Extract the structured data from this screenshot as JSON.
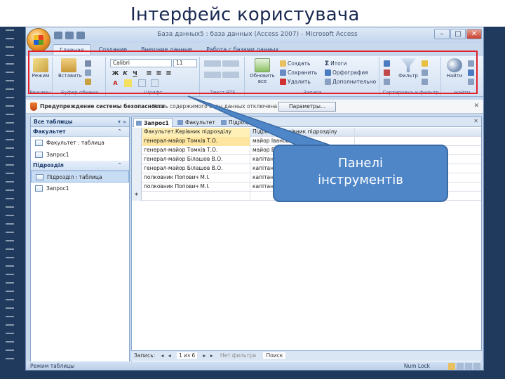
{
  "slide": {
    "title": "Інтерфейс користувача",
    "callout": {
      "line1": "Панелі",
      "line2": "інструментів"
    }
  },
  "window": {
    "title": "База данных5 : база данных (Access 2007) - Microsoft Access",
    "controls": {
      "minimize": "–",
      "maximize": "□",
      "close": "✕"
    }
  },
  "ribbon": {
    "tabs": [
      {
        "label": "Главная",
        "active": true
      },
      {
        "label": "Создание",
        "active": false
      },
      {
        "label": "Внешние данные",
        "active": false
      },
      {
        "label": "Работа с базами данных",
        "active": false
      }
    ],
    "groups": {
      "modes": {
        "label": "Режимы",
        "button": "Режим"
      },
      "clipboard": {
        "label": "Буфер обмена",
        "button": "Вставить"
      },
      "font": {
        "label": "Шрифт",
        "font_name": "Calibri",
        "font_size": "11",
        "bold": "Ж",
        "italic": "К",
        "underline": "Ч"
      },
      "rich_text": {
        "label": "Текст RTF"
      },
      "records": {
        "label": "Записи",
        "refresh": "Обновить все",
        "create": "Создать",
        "save": "Сохранить",
        "delete": "Удалить",
        "totals": "Итоги",
        "spelling": "Орфография",
        "more": "Дополнительно"
      },
      "sort_filter": {
        "label": "Сортировка и фильтр",
        "filter": "Фильтр"
      },
      "find": {
        "label": "Найти",
        "find": "Найти"
      }
    }
  },
  "security_bar": {
    "title": "Предупреждение системы безопасности",
    "message": "Часть содержимого базы данных отключена",
    "button": "Параметры..."
  },
  "nav_pane": {
    "header": "Все таблицы",
    "sections": [
      {
        "title": "Факультет",
        "items": [
          "Факультет : таблица",
          "Запрос1"
        ]
      },
      {
        "title": "Підрозділ",
        "items": [
          "Підрозділ : таблица",
          "Запрос1"
        ]
      }
    ]
  },
  "document": {
    "tabs": [
      "Запрос1",
      "Факультет",
      "Підрозділ"
    ],
    "columns": [
      "Факультет.Керівник підрозділу",
      "Підрозділ.Керівник підрозділу"
    ],
    "rows": [
      [
        "генерал-майор Томків Т.О.",
        "майор Іванов О."
      ],
      [
        "генерал-майор Томків Т.О.",
        "майор Б..."
      ],
      [
        "генерал-майор Білашов В.О.",
        "капітан..."
      ],
      [
        "генерал-майор Білашов В.О.",
        "капітан..."
      ],
      [
        "полковник Попович М.І.",
        "капітан..."
      ],
      [
        "полковник Попович М.І.",
        "капітан..."
      ]
    ],
    "new_row_marker": "*"
  },
  "record_nav": {
    "label": "Запись:",
    "current": "1 из 6",
    "filter": "Нет фильтра",
    "search": "Поиск"
  },
  "status": {
    "mode": "Режим таблицы",
    "num_lock": "Num Lock"
  }
}
